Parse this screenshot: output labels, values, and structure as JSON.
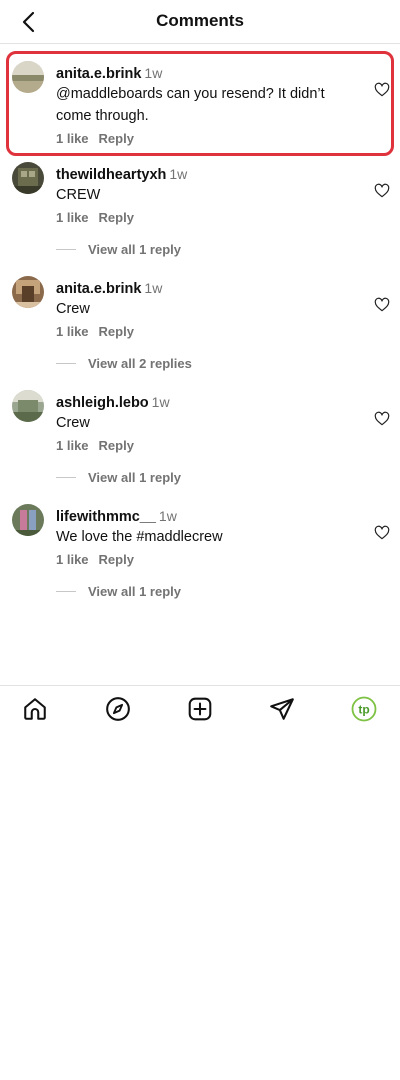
{
  "header": {
    "title": "Comments"
  },
  "comments": [
    {
      "username": "anita.e.brink",
      "time": "1w",
      "text_line1": "@maddleboards can you resend? It didn’t",
      "text_line2": "come through.",
      "likes": "1 like",
      "reply": "Reply",
      "view_replies": ""
    },
    {
      "username": "thewildheartyxh",
      "time": "1w",
      "text": "CREW",
      "likes": "1 like",
      "reply": "Reply",
      "view_replies": "View all 1 reply"
    },
    {
      "username": "anita.e.brink",
      "time": "1w",
      "text": "Crew",
      "likes": "1 like",
      "reply": "Reply",
      "view_replies": "View all 2 replies"
    },
    {
      "username": "ashleigh.lebo",
      "time": "1w",
      "text": "Crew",
      "likes": "1 like",
      "reply": "Reply",
      "view_replies": "View all 1 reply"
    },
    {
      "username": "lifewithmmc__",
      "time": "1w",
      "text": "We love the #maddlecrew",
      "likes": "1 like",
      "reply": "Reply",
      "view_replies": "View all 1 reply"
    }
  ],
  "tabbar": {
    "profile_initials": "tp",
    "icons": [
      "home-icon",
      "explore-icon",
      "create-icon",
      "send-icon",
      "profile-avatar"
    ]
  },
  "colors": {
    "highlight": "#e0323c",
    "secondary_text": "#737373",
    "profile_accent": "#7dc242"
  }
}
